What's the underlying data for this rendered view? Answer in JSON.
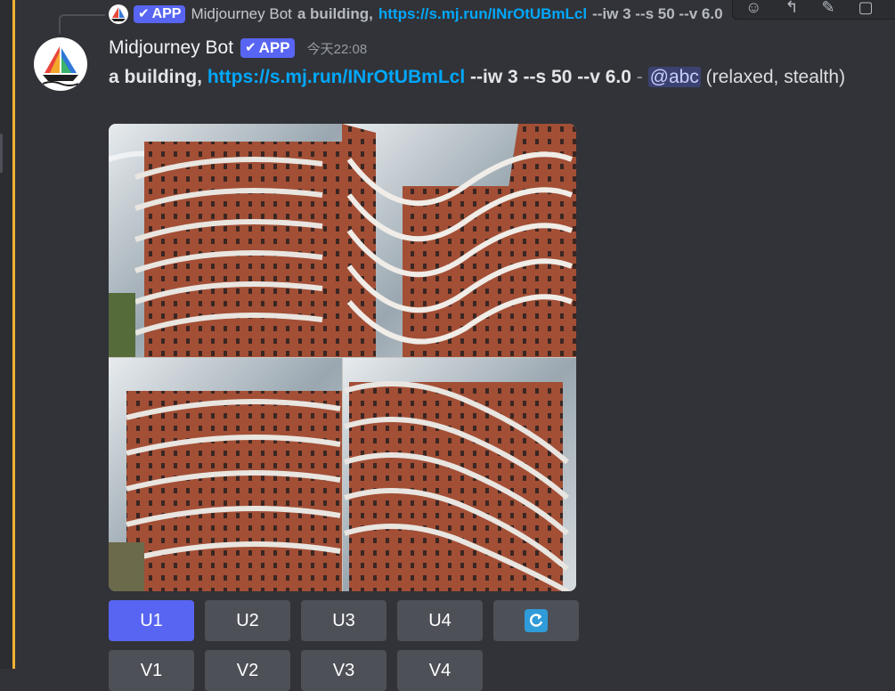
{
  "reply": {
    "author": "Midjourney Bot",
    "badge": "APP",
    "text_bold": "a building,",
    "link": "https://s.mj.run/INrOtUBmLcl",
    "text_tail": "--iw 3 --s 50 --v 6.0"
  },
  "message": {
    "author": "Midjourney Bot",
    "badge": "APP",
    "timestamp": "今天22:08",
    "prompt_bold": "a building,",
    "link": "https://s.mj.run/INrOtUBmLcl",
    "params": "--iw 3 --s 50 --v 6.0",
    "separator": "-",
    "mention": "@abc",
    "mode": "(relaxed, stealth)"
  },
  "buttons": {
    "row1": [
      "U1",
      "U2",
      "U3",
      "U4"
    ],
    "row2": [
      "V1",
      "V2",
      "V3",
      "V4"
    ],
    "refresh_icon": "refresh-icon"
  },
  "icons": {
    "reply_avatar": "sailboat-logo-icon",
    "avatar": "sailboat-logo-icon",
    "badge_check": "checkmark-icon",
    "toolbar": [
      "reaction-icon",
      "reply-icon",
      "edit-icon",
      "more-icon"
    ]
  },
  "colors": {
    "background": "#323338",
    "accent": "#5865f2",
    "link": "#00a8fc",
    "highlight": "#f0b232",
    "mention_bg": "#3c4270"
  }
}
